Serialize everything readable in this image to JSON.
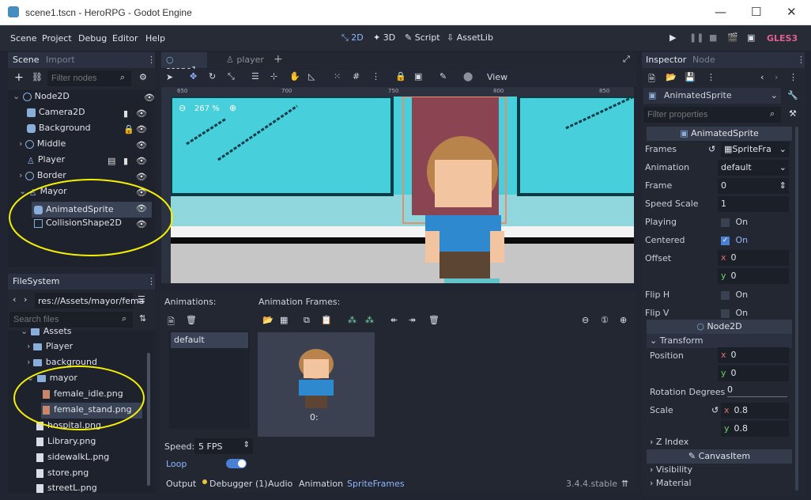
{
  "window": {
    "title": "scene1.tscn - HeroRPG - Godot Engine",
    "minimize": "—",
    "maximize": "☐",
    "close": "✕"
  },
  "menu": [
    "Scene",
    "Project",
    "Debug",
    "Editor",
    "Help"
  ],
  "modes": {
    "two_d": "2D",
    "three_d": "3D",
    "script": "Script",
    "assetlib": "AssetLib"
  },
  "renderer": "GLES3",
  "scene_dock": {
    "tab_active": "Scene",
    "tab_inactive": "Import",
    "filter_placeholder": "Filter nodes",
    "nodes": [
      {
        "label": "Node2D",
        "icon": "node2d-icon"
      },
      {
        "label": "Camera2D",
        "icon": "camera2d-icon"
      },
      {
        "label": "Background",
        "icon": "sprite-icon"
      },
      {
        "label": "Middle",
        "icon": "node2d-icon"
      },
      {
        "label": "Player",
        "icon": "kinematic-icon"
      },
      {
        "label": "Border",
        "icon": "node2d-icon"
      },
      {
        "label": "Mayor",
        "icon": "kinematic-icon"
      },
      {
        "label": "AnimatedSprite",
        "icon": "animatedsprite-icon"
      },
      {
        "label": "CollisionShape2D",
        "icon": "collisionshape-icon"
      }
    ]
  },
  "filesystem": {
    "tab": "FileSystem",
    "path": "res://Assets/mayor/fema",
    "search_placeholder": "Search files",
    "items": [
      {
        "label": "Assets",
        "type": "folder"
      },
      {
        "label": "Player",
        "type": "folder"
      },
      {
        "label": "background",
        "type": "folder"
      },
      {
        "label": "mayor",
        "type": "folder"
      },
      {
        "label": "female_idle.png",
        "type": "image"
      },
      {
        "label": "female_stand.png",
        "type": "image"
      },
      {
        "label": "hospital.png",
        "type": "image"
      },
      {
        "label": "Library.png",
        "type": "image"
      },
      {
        "label": "sidewalkL.png",
        "type": "image"
      },
      {
        "label": "store.png",
        "type": "image"
      },
      {
        "label": "streetL.png",
        "type": "image"
      }
    ]
  },
  "editor_tabs": {
    "scene1": "scene1",
    "player": "player"
  },
  "viewport": {
    "zoom": "267 %",
    "view_label": "View",
    "ruler": [
      "650",
      "700",
      "750",
      "800",
      "850"
    ]
  },
  "spriteframes": {
    "animations_label": "Animations:",
    "frames_label": "Animation Frames:",
    "animation_item": "default",
    "frame_caption": "0:",
    "speed_label": "Speed:",
    "speed_value": "5 FPS",
    "loop_label": "Loop"
  },
  "bottom_tabs": [
    "Output",
    "Debugger (1)",
    "Audio",
    "Animation",
    "SpriteFrames"
  ],
  "version": "3.4.4.stable",
  "inspector": {
    "tab_active": "Inspector",
    "tab_inactive": "Node",
    "node_name": "AnimatedSprite",
    "filter_placeholder": "Filter properties",
    "section_animatedsprite": "AnimatedSprite",
    "frames_label": "Frames",
    "frames_value": "SpriteFra",
    "animation_label": "Animation",
    "animation_value": "default",
    "frame_label": "Frame",
    "frame_value": "0",
    "speed_scale_label": "Speed Scale",
    "speed_scale_value": "1",
    "playing_label": "Playing",
    "playing_value": "On",
    "centered_label": "Centered",
    "centered_value": "On",
    "offset_label": "Offset",
    "offset_x": "0",
    "offset_y": "0",
    "fliph_label": "Flip H",
    "fliph_value": "On",
    "flipv_label": "Flip V",
    "flipv_value": "On",
    "section_node2d": "Node2D",
    "transform_label": "Transform",
    "position_label": "Position",
    "position_x": "0",
    "position_y": "0",
    "rotation_label": "Rotation Degrees",
    "rotation_value": "0",
    "scale_label": "Scale",
    "scale_x": "0.8",
    "scale_y": "0.8",
    "zindex_label": "Z Index",
    "section_canvasitem": "CanvasItem",
    "visibility_label": "Visibility",
    "material_label": "Material",
    "axis_x": "x",
    "axis_y": "y"
  },
  "colors": {
    "accent": "#8fb6ff",
    "renderer": "#e06090",
    "annotation": "#f4f000",
    "sky": "#4cd3e0"
  }
}
